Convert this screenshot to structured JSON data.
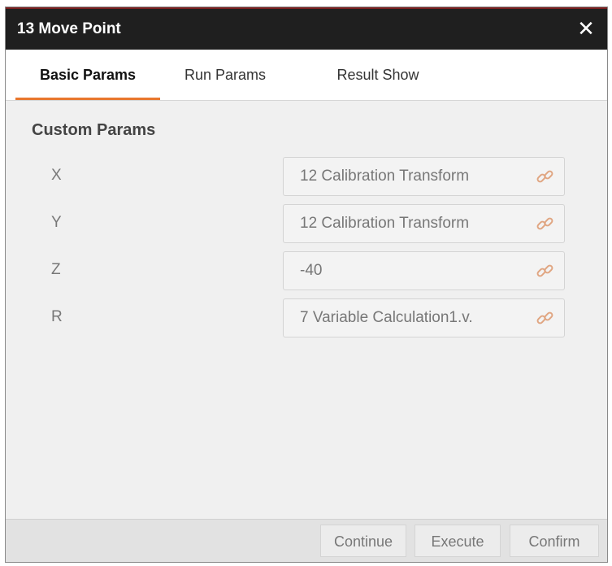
{
  "window": {
    "title": "13 Move Point",
    "close_icon": "close-icon"
  },
  "tabs": [
    {
      "label": "Basic Params",
      "active": true
    },
    {
      "label": "Run Params",
      "active": false
    },
    {
      "label": "Result Show",
      "active": false
    }
  ],
  "section": {
    "title": "Custom Params"
  },
  "params": [
    {
      "label": "X",
      "value": "12 Calibration Transform",
      "icon": "link-icon"
    },
    {
      "label": "Y",
      "value": "12 Calibration Transform",
      "icon": "link-icon"
    },
    {
      "label": "Z",
      "value": "-40",
      "icon": "link-icon"
    },
    {
      "label": "R",
      "value": "7 Variable Calculation1.v.",
      "icon": "link-icon"
    }
  ],
  "buttons": {
    "continue": "Continue",
    "execute": "Execute",
    "confirm": "Confirm"
  },
  "colors": {
    "accent": "#e8772e",
    "titlebar": "#1f1f1f",
    "link_icon": "#e0a581"
  }
}
